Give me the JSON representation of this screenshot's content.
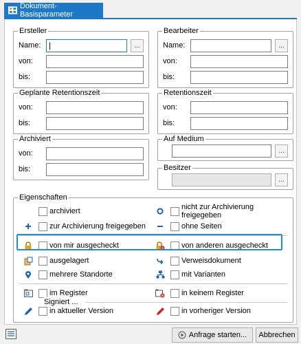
{
  "tab": {
    "title": "Dokument-Basisparameter"
  },
  "ersteller": {
    "legend": "Ersteller",
    "name_label": "Name:",
    "von_label": "von:",
    "bis_label": "bis:",
    "name_value": "|",
    "browse": "..."
  },
  "bearbeiter": {
    "legend": "Bearbeiter",
    "name_label": "Name:",
    "von_label": "von:",
    "bis_label": "bis:",
    "browse": "..."
  },
  "geplante": {
    "legend": "Geplante Retentionszeit",
    "von_label": "von:",
    "bis_label": "bis:"
  },
  "retention": {
    "legend": "Retentionszeit",
    "von_label": "von:",
    "bis_label": "bis:"
  },
  "archiviert": {
    "legend": "Archiviert",
    "von_label": "von:",
    "bis_label": "bis:"
  },
  "medium": {
    "legend": "Auf Medium",
    "browse": "..."
  },
  "besitzer": {
    "legend": "Besitzer",
    "browse": "..."
  },
  "eigenschaften": {
    "legend": "Eigenschaften",
    "archiviert": "archiviert",
    "nicht_archiv": "nicht zur Archivierung freigegeben",
    "zur_archiv": "zur Archivierung freigegeben",
    "ohne_seiten": "ohne Seiten",
    "von_mir": "von mir ausgecheckt",
    "von_anderen": "von anderen ausgecheckt",
    "ausgelagert": "ausgelagert",
    "verweis": "Verweisdokument",
    "standorte": "mehrere Standorte",
    "varianten": "mit Varianten",
    "im_register": "im Register",
    "kein_register": "in keinem Register",
    "signiert": "Signiert ...",
    "aktuelle": "in aktueller Version",
    "vorherige": "in vorheriger Version"
  },
  "footer": {
    "start_label": "Anfrage starten...",
    "cancel_label": "Abbrechen"
  },
  "colors": {
    "accent": "#1e78c8",
    "highlight": "#1e8ed8",
    "pencil_blue": "#1e64b4",
    "pencil_red": "#d02020",
    "lock_orange": "#e8a020"
  }
}
